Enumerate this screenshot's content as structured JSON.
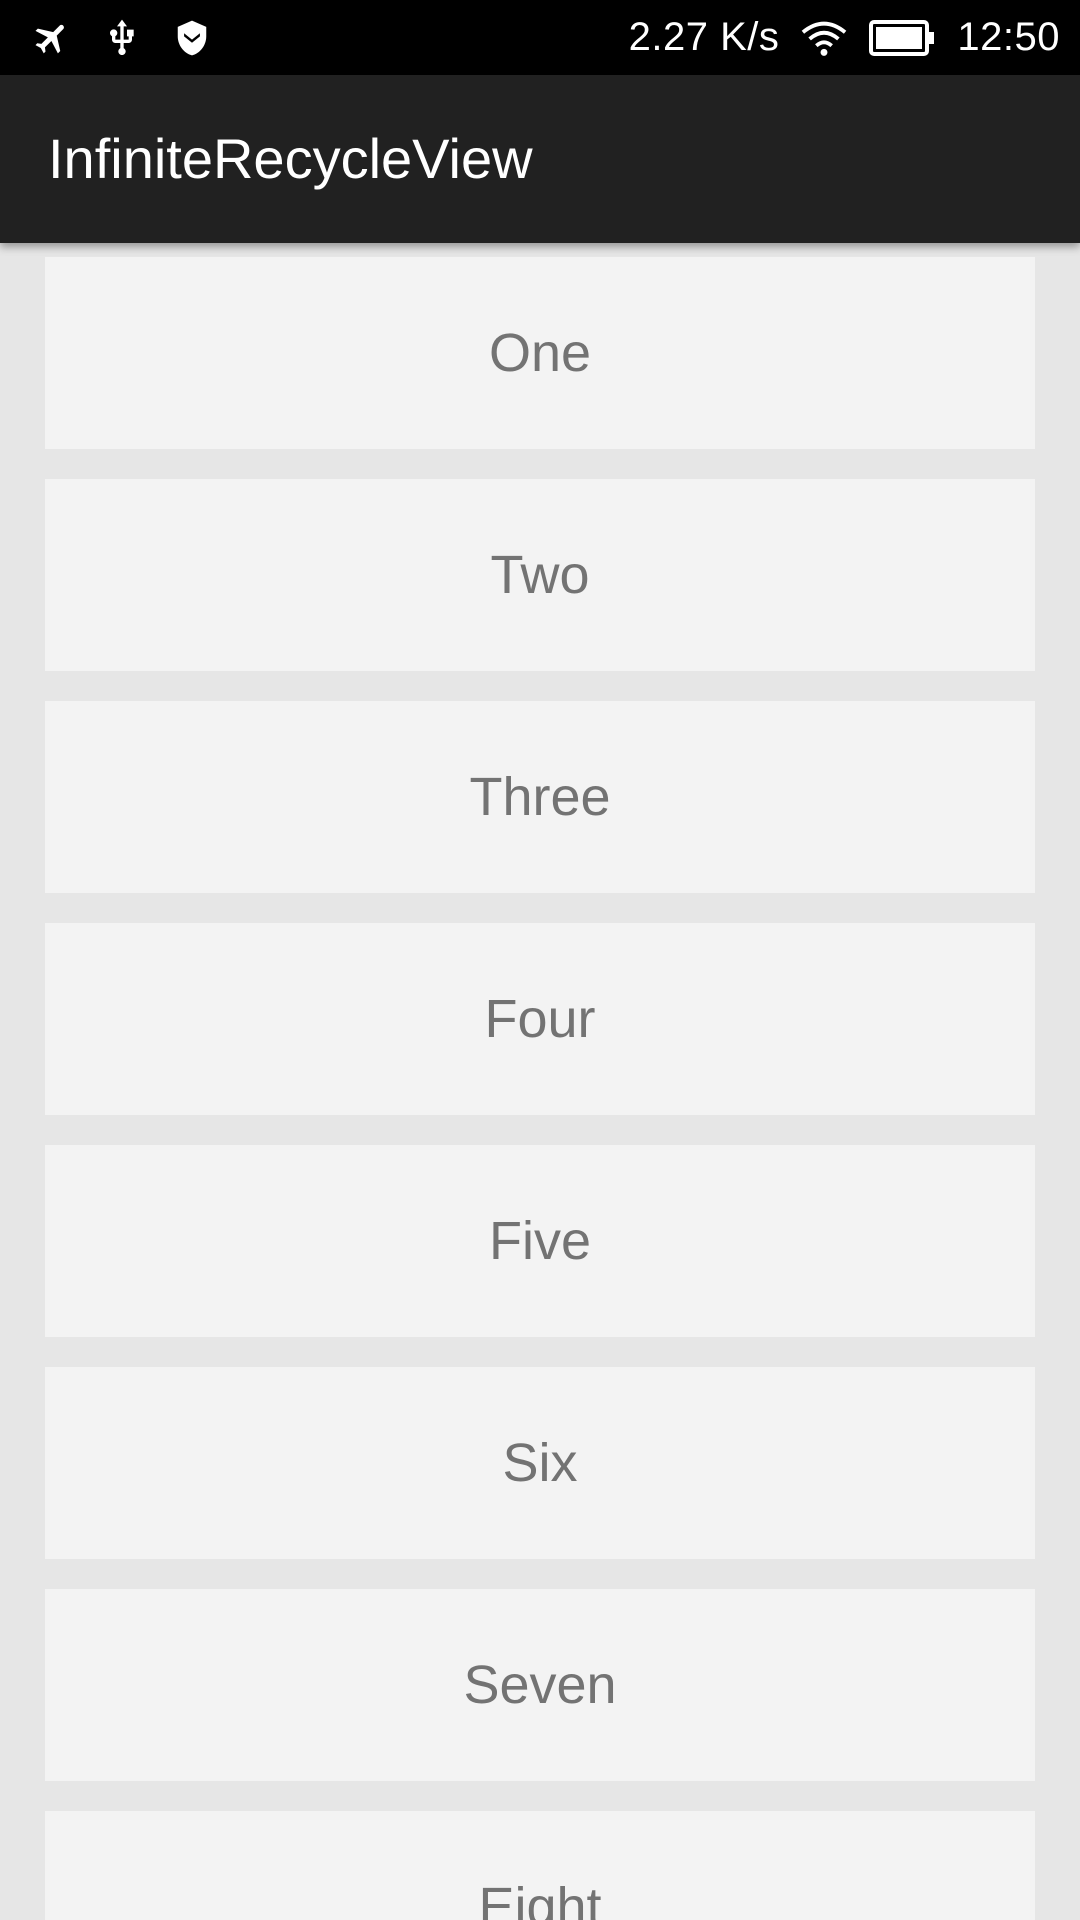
{
  "status_bar": {
    "icons_left": [
      "airplane-icon",
      "usb-icon",
      "shield-icon"
    ],
    "network_speed": "2.27 K/s",
    "icons_right": [
      "wifi-icon",
      "battery-icon"
    ],
    "time": "12:50"
  },
  "app_bar": {
    "title": "InfiniteRecycleView"
  },
  "list": {
    "items": [
      {
        "label": "One"
      },
      {
        "label": "Two"
      },
      {
        "label": "Three"
      },
      {
        "label": "Four"
      },
      {
        "label": "Five"
      },
      {
        "label": "Six"
      },
      {
        "label": "Seven"
      },
      {
        "label": "Eight"
      }
    ]
  },
  "colors": {
    "status_bar": "#000000",
    "app_bar": "#212121",
    "list_background": "#e6e6e6",
    "card_background": "#f3f3f3",
    "card_text": "#737373"
  }
}
